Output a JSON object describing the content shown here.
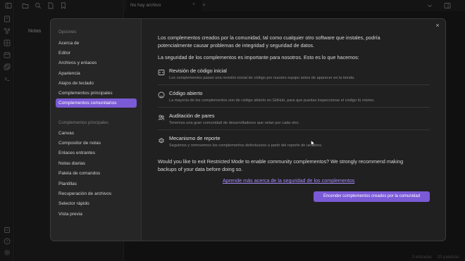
{
  "sidebar": {
    "notes_label": "Notas"
  },
  "tab": {
    "title": "No hay archivo",
    "close_glyph": "×",
    "add_glyph": "+"
  },
  "status": {
    "entries": "3 entradas",
    "words": "20 palabras"
  },
  "modal": {
    "close_glyph": "×",
    "nav": {
      "options_heading": "Opciones",
      "options": [
        "Acerca de",
        "Editor",
        "Archivos y enlaces",
        "Apariencia",
        "Atajos de teclado",
        "Complementos principales",
        "Complementos comunitarios"
      ],
      "active_index": 6,
      "plugins_heading": "Complementos principales",
      "plugins": [
        "Canvas",
        "Compositor de notas",
        "Enlaces entrantes",
        "Notas diarias",
        "Paleta de comandos",
        "Plantillas",
        "Recuperación de archivos",
        "Selector rápido",
        "Vista previa"
      ]
    },
    "content": {
      "intro_line1": "Los complementos creados por la comunidad, tal como cualquier otro software que instales, podría",
      "intro_line2": "potencialmente causar problemas de integridad y seguridad de datos.",
      "security_line": "La seguridad de los complementos es importante para nosotros. Esto es lo que hacemos:",
      "features": [
        {
          "icon": "code-review-icon",
          "title": "Revisión de código inicial",
          "desc": "Los complementos pasan una revisión inicial de código por nuestro equipo antes de aparecer en la tienda."
        },
        {
          "icon": "github-icon",
          "title": "Código abierto",
          "desc": "La mayoría de los complementos son de código abierto en GitHub, para que puedas inspeccionar el código tú mismo."
        },
        {
          "icon": "users-icon",
          "title": "Auditación de pares",
          "desc": "Tenemos una gran comunidad de desarrolladores que velan por cada otro."
        },
        {
          "icon": "bug-icon",
          "title": "Mecanismo de reporte",
          "desc": "Seguimos y removemos los complementos defectuosos a partir del reporte de usuarios."
        }
      ],
      "restricted_line1": "Would you like to exit Restricted Mode to enable community complementos? We strongly recommend making",
      "restricted_line2": "backups of your data before doing so.",
      "learn_link": "Aprende más acerca de la seguridad de los complementos",
      "cta_label": "Encender complementos creados por la comunidad"
    }
  },
  "colors": {
    "accent": "#7b5ad6",
    "link": "#a88bfa",
    "background": "#1e1e1e"
  }
}
